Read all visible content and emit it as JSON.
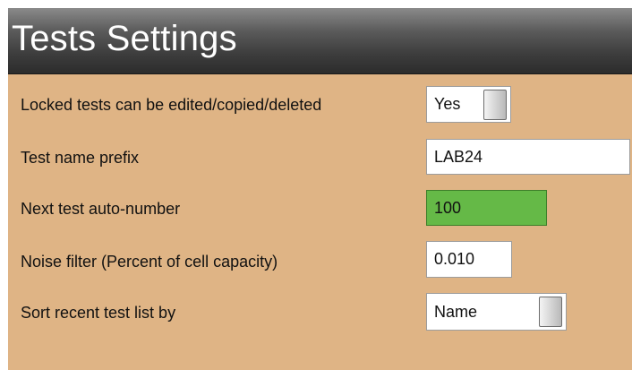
{
  "title": "Tests Settings",
  "settings": {
    "locked_tests": {
      "label": "Locked tests can be edited/copied/deleted",
      "value": "Yes"
    },
    "name_prefix": {
      "label": "Test name prefix",
      "value": "LAB24"
    },
    "auto_number": {
      "label": "Next test auto-number",
      "value": "100"
    },
    "noise_filter": {
      "label": "Noise filter (Percent of cell capacity)",
      "value": "0.010"
    },
    "sort_by": {
      "label": "Sort recent test list by",
      "value": "Name"
    }
  },
  "colors": {
    "panel_background": "#dfb485",
    "highlight_field": "#65b947"
  }
}
